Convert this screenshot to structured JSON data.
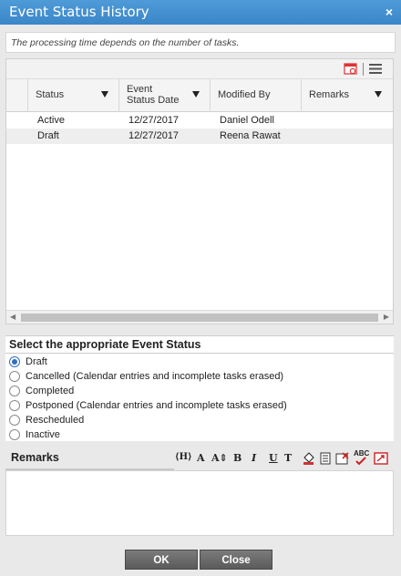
{
  "dialog": {
    "title": "Event Status History",
    "close_label": "×"
  },
  "info_text": "The processing time depends on the number of tasks.",
  "grid": {
    "columns": [
      "Status",
      "Event Status Date",
      "Modified By",
      "Remarks"
    ],
    "rows": [
      {
        "status": "Active",
        "date": "12/27/2017",
        "modified_by": "Daniel Odell",
        "remarks": ""
      },
      {
        "status": "Draft",
        "date": "12/27/2017",
        "modified_by": "Reena Rawat",
        "remarks": ""
      }
    ]
  },
  "status_section": {
    "title": "Select the appropriate Event Status",
    "selected": "Draft",
    "options": [
      "Draft",
      "Cancelled (Calendar entries and incomplete tasks erased)",
      "Completed",
      "Postponed (Calendar entries and incomplete tasks erased)",
      "Rescheduled",
      "Inactive"
    ]
  },
  "remarks": {
    "label": "Remarks",
    "toolbar": {
      "heading": "⟨H⟩",
      "font": "A",
      "font_size": "A⇕",
      "bold": "B",
      "italic": "I",
      "underline": "U",
      "clear_format": "T",
      "spellcheck": "ABC"
    }
  },
  "buttons": {
    "ok": "OK",
    "close": "Close"
  },
  "colors": {
    "title_bar": "#4590d0",
    "radio_selected": "#2f6fc6",
    "button": "#6a6a6a"
  }
}
